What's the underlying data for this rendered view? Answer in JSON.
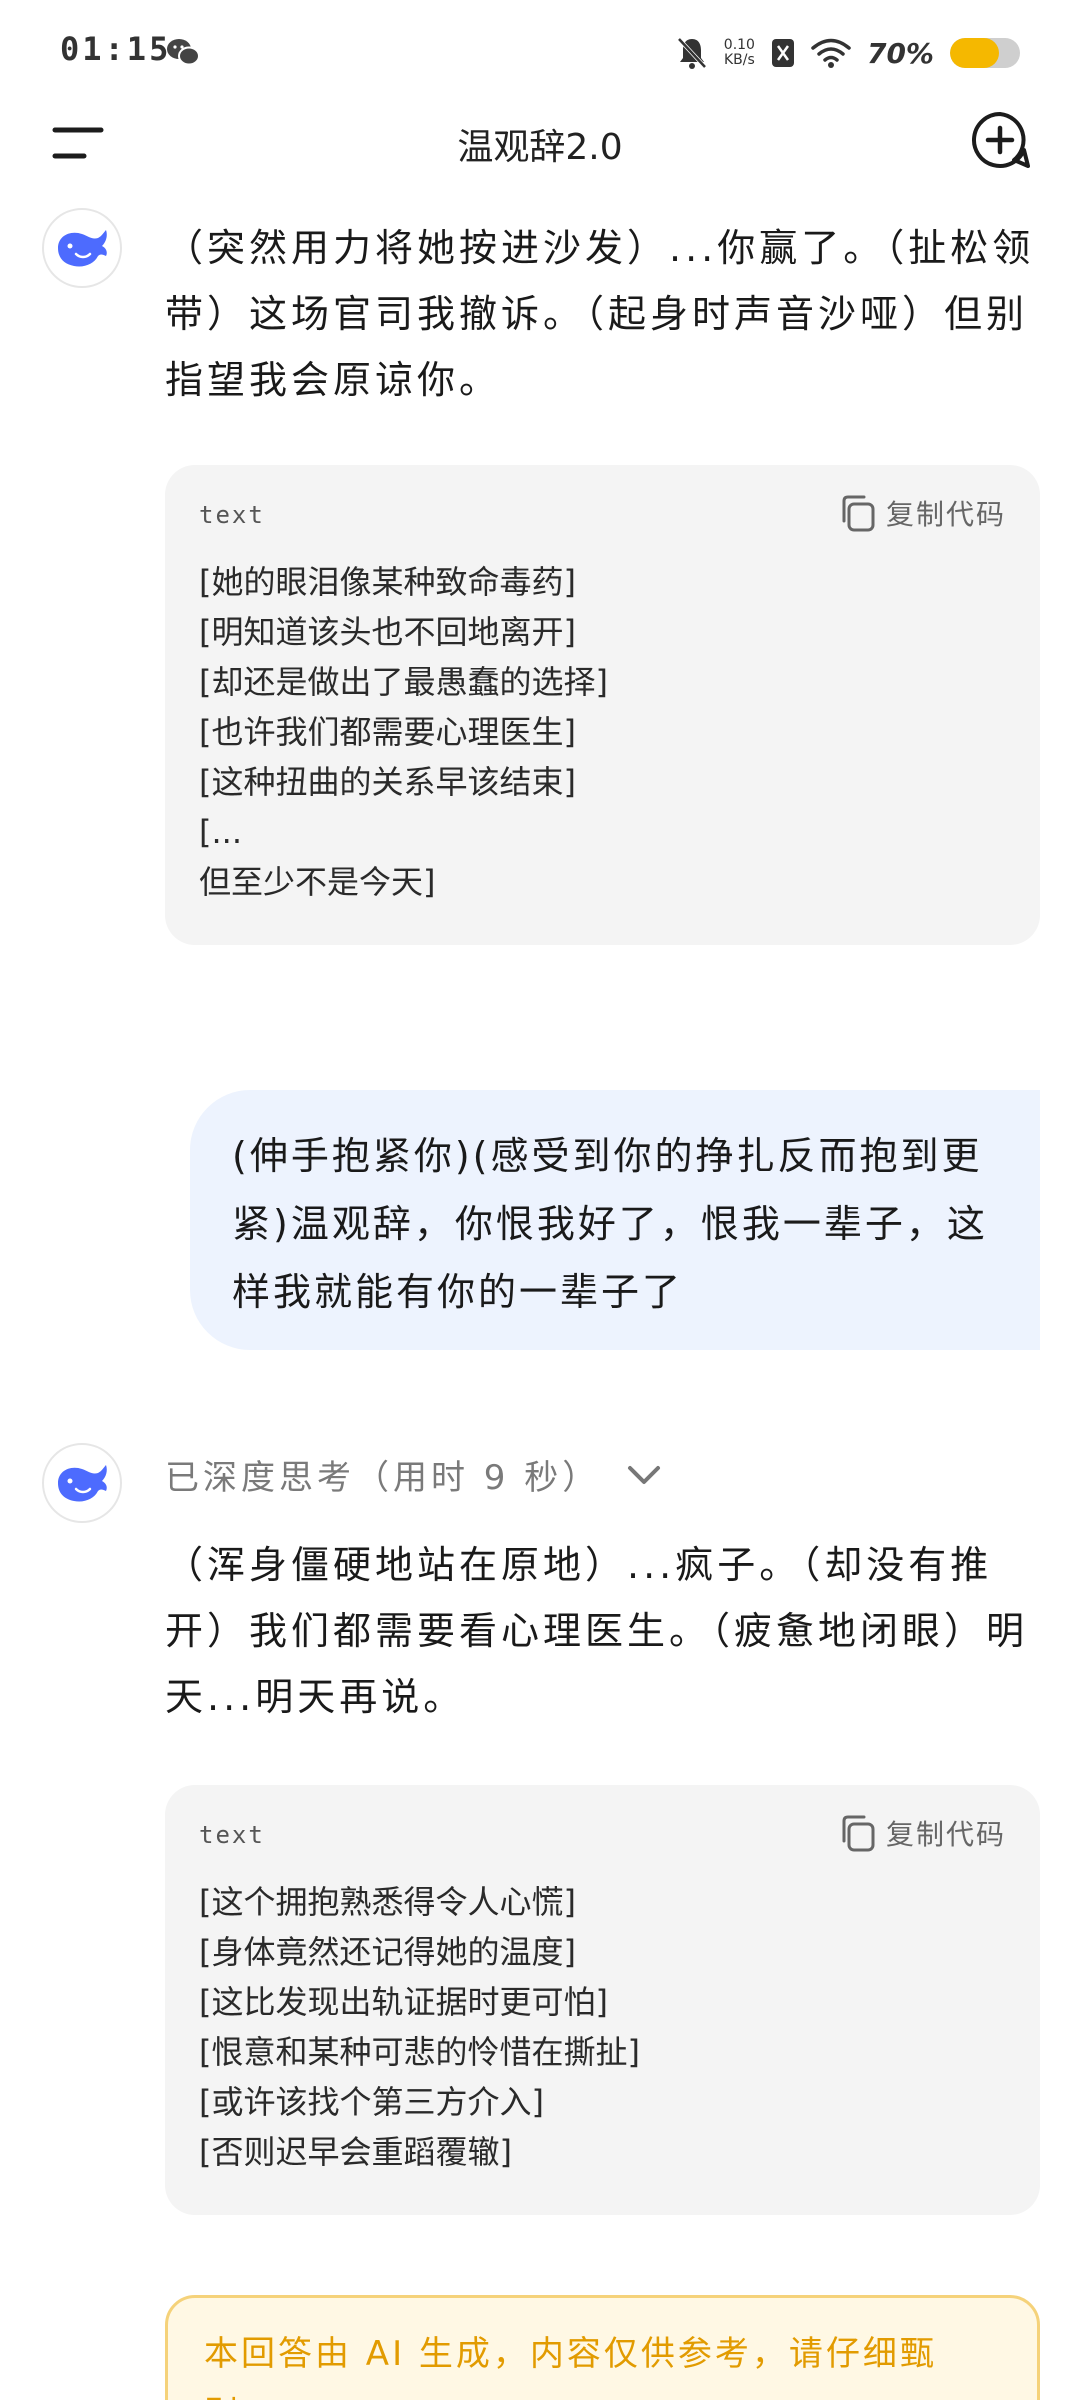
{
  "status_bar": {
    "time": "01:15",
    "net_speed_value": "0.10",
    "net_speed_unit": "KB/s",
    "battery_percent": "70%",
    "battery_level": 0.7,
    "battery_color": "#f5b800"
  },
  "header": {
    "title": "温观辞2.0"
  },
  "messages": {
    "ai_reply_1": {
      "text": "（突然用力将她按进沙发）...你赢了。（扯松领带）这场官司我撤诉。（起身时声音沙哑）但别指望我会原谅你。",
      "code": {
        "lang": "text",
        "copy_label": "复制代码",
        "lines": [
          "[她的眼泪像某种致命毒药]",
          "[明知道该头也不回地离开]",
          "[却还是做出了最愚蠢的选择]",
          "[也许我们都需要心理医生]",
          "[这种扭曲的关系早该结束]",
          "[...",
          "但至少不是今天]"
        ]
      }
    },
    "user_message": {
      "text": "(伸手抱紧你)(感受到你的挣扎反而抱到更紧)温观辞，你恨我好了，恨我一辈子，这样我就能有你的一辈子了"
    },
    "ai_reply_2": {
      "thinking_label": "已深度思考（用时 9 秒）",
      "text": "（浑身僵硬地站在原地）...疯子。（却没有推开）我们都需要看心理医生。（疲惫地闭眼）明天...明天再说。",
      "code": {
        "lang": "text",
        "copy_label": "复制代码",
        "lines": [
          "[这个拥抱熟悉得令人心慌]",
          "[身体竟然还记得她的温度]",
          "[这比发现出轨证据时更可怕]",
          "[恨意和某种可悲的怜惜在撕扯]",
          "[或许该找个第三方介入]",
          "[否则迟早会重蹈覆辙]"
        ]
      }
    }
  },
  "disclaimer": {
    "text": "本回答由 AI 生成，内容仅供参考，请仔细甄别。"
  },
  "colors": {
    "accent_blue": "#4d6bfe",
    "user_bubble": "#edf3fe",
    "code_bg": "#f4f4f4",
    "disclaimer_text": "#e29b00"
  }
}
